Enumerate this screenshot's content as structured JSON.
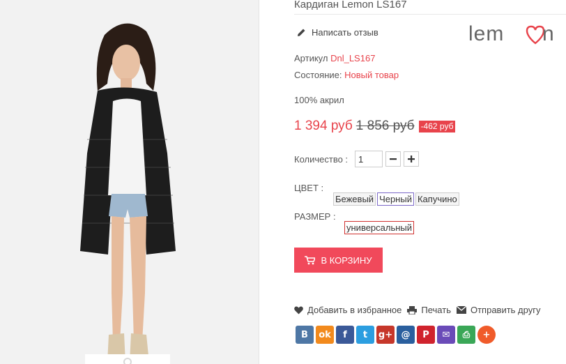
{
  "product": {
    "title": "Кардиган Lemon LS167",
    "review_label": "Написать отзыв",
    "article_label": "Артикул",
    "article_value": "Dnl_LS167",
    "condition_label": "Состояние:",
    "condition_value": "Новый товар",
    "description": "100% акрил",
    "price_current": "1 394 руб",
    "price_old": "1 856 руб",
    "discount": "-462 руб",
    "quantity_label": "Количество :",
    "quantity_value": "1",
    "minus_icon": "minus-icon",
    "plus_icon": "plus-icon"
  },
  "brand": {
    "logo_text": "lemon"
  },
  "attributes": {
    "color_label": "ЦВЕТ :",
    "colors": [
      "Бежевый",
      "Черный",
      "Капучино"
    ],
    "color_selected": "Черный",
    "size_label": "РАЗМЕР :",
    "sizes": [
      "универсальный"
    ],
    "size_selected": "универсальный"
  },
  "cart": {
    "label": "В КОРЗИНУ",
    "icon": "cart-icon"
  },
  "actions": {
    "wishlist": "Добавить в избранное",
    "print": "Печать",
    "send": "Отправить другу"
  },
  "social": [
    {
      "name": "vk",
      "glyph": "B",
      "color": "#4e77a5"
    },
    {
      "name": "odnoklassniki",
      "glyph": "ok",
      "color": "#f28a1d"
    },
    {
      "name": "facebook",
      "glyph": "f",
      "color": "#3b5998"
    },
    {
      "name": "twitter",
      "glyph": "t",
      "color": "#2c9ee0"
    },
    {
      "name": "google-plus",
      "glyph": "g+",
      "color": "#c6372a"
    },
    {
      "name": "mail",
      "glyph": "@",
      "color": "#2a5f9e"
    },
    {
      "name": "pinterest",
      "glyph": "P",
      "color": "#d0232d"
    },
    {
      "name": "email",
      "glyph": "✉",
      "color": "#6a4bb8"
    },
    {
      "name": "print",
      "glyph": "⎙",
      "color": "#3aa757"
    },
    {
      "name": "more",
      "glyph": "+",
      "color": "#f05b2a"
    }
  ],
  "colors": {
    "accent": "#e8434b",
    "button": "#f1495b"
  }
}
